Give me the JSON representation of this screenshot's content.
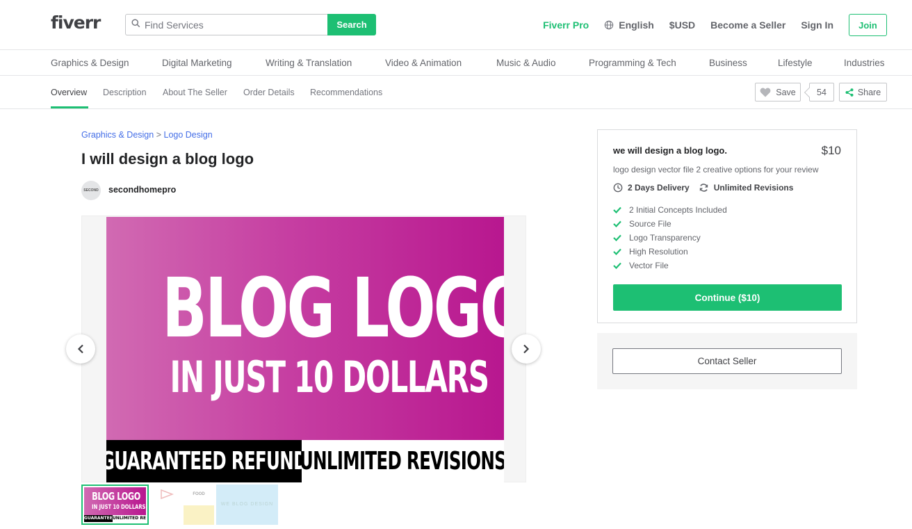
{
  "header": {
    "logo": "fiverr",
    "search_placeholder": "Find Services",
    "search_button": "Search",
    "nav": {
      "pro": "Fiverr Pro",
      "language": "English",
      "currency": "$USD",
      "become_seller": "Become a Seller",
      "sign_in": "Sign In",
      "join": "Join"
    }
  },
  "categories": [
    "Graphics & Design",
    "Digital Marketing",
    "Writing & Translation",
    "Video & Animation",
    "Music & Audio",
    "Programming & Tech",
    "Business",
    "Lifestyle",
    "Industries"
  ],
  "subnav": {
    "tabs": [
      "Overview",
      "Description",
      "About The Seller",
      "Order Details",
      "Recommendations"
    ],
    "save": "Save",
    "save_count": "54",
    "share": "Share"
  },
  "gig": {
    "breadcrumb": [
      "Graphics & Design",
      "Logo Design"
    ],
    "breadcrumb_sep": ">",
    "title": "I will design a blog logo",
    "seller": "secondhomepro",
    "avatar_text": "SECOND",
    "image": {
      "line1": "BLOG LOGO",
      "line2": "IN JUST 10 DOLLARS",
      "bar_left": "GUARANTEED REFUND",
      "bar_right": "UNLIMITED REVISIONS"
    },
    "thumb2_texts": [
      "",
      "FOOD",
      "",
      ""
    ],
    "thumb3_text": "WE BLOG DESIGN"
  },
  "package": {
    "title": "we will design a blog logo.",
    "price": "$10",
    "description": "logo design vector file 2 creative options for your review",
    "delivery": "2 Days Delivery",
    "revisions": "Unlimited Revisions",
    "features": [
      "2 Initial Concepts Included",
      "Source File",
      "Logo Transparency",
      "High Resolution",
      "Vector File"
    ],
    "continue_button": "Continue ($10)",
    "contact_button": "Contact Seller"
  },
  "colors": {
    "brand_green": "#1dbf73",
    "link_blue": "#446ee7",
    "text_dark": "#404145"
  }
}
